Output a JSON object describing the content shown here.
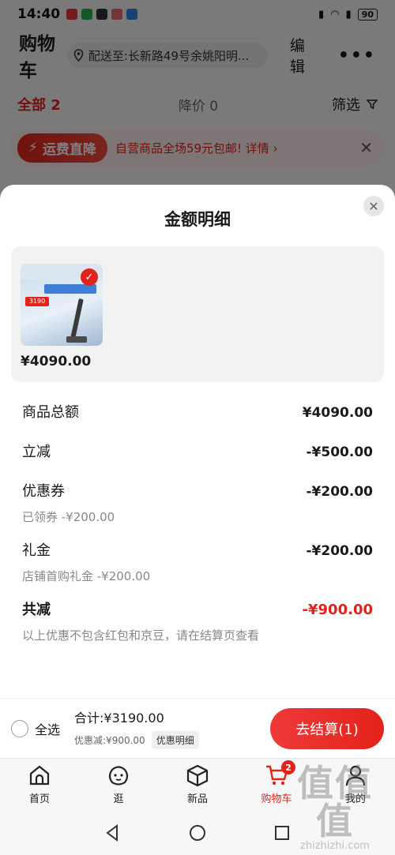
{
  "status_bar": {
    "time": "14:40",
    "battery": "90"
  },
  "header": {
    "title": "购物车",
    "address": "配送至:长新路49号余姚阳明...",
    "edit": "编辑",
    "more": "•••"
  },
  "tabs": {
    "all": "全部 2",
    "price_drop": "降价 0",
    "filter": "筛选"
  },
  "promo": {
    "tag": "运费直降",
    "text": "自营商品全场59元包邮! 详情 ›"
  },
  "sheet": {
    "title": "金额明细",
    "goods_price": "¥4090.00",
    "thumb_price": "3190",
    "rows": {
      "total_label": "商品总额",
      "total_value": "¥4090.00",
      "instant_label": "立减",
      "instant_value": "-¥500.00",
      "coupon_label": "优惠券",
      "coupon_value": "-¥200.00",
      "coupon_sub": "已领券 -¥200.00",
      "gift_label": "礼金",
      "gift_value": "-¥200.00",
      "gift_sub": "店铺首购礼金 -¥200.00",
      "saved_label": "共减",
      "saved_value": "-¥900.00",
      "note": "以上优惠不包含红包和京豆，请在结算页查看"
    }
  },
  "checkout": {
    "select_all": "全选",
    "sum": "合计:¥3190.00",
    "discount": "优惠减:¥900.00",
    "detail_link": "优惠明细",
    "pay": "去结算(1)"
  },
  "nav": {
    "items": [
      {
        "label": "首页",
        "icon": "home-icon"
      },
      {
        "label": "逛",
        "icon": "browse-icon"
      },
      {
        "label": "新品",
        "icon": "box-icon"
      },
      {
        "label": "购物车",
        "icon": "cart-icon",
        "badge": "2",
        "active": true
      },
      {
        "label": "我的",
        "icon": "user-icon"
      }
    ]
  },
  "watermark": {
    "big": "值值值",
    "small": "zhizhizhi.com"
  },
  "colors": {
    "accent": "#e2231a"
  }
}
